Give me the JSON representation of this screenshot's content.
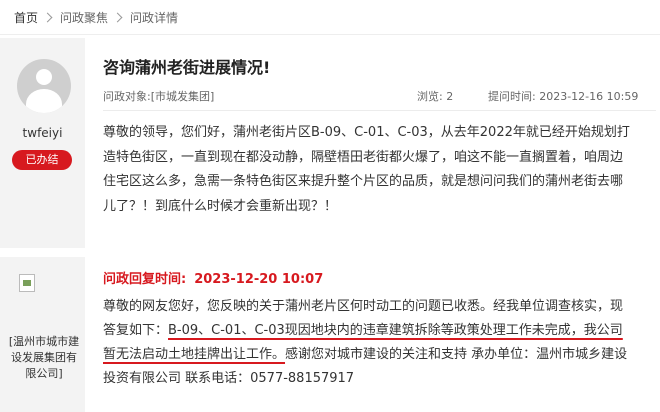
{
  "breadcrumb": {
    "items": [
      "首页",
      "问政聚焦",
      "问政详情"
    ]
  },
  "post": {
    "username": "twfeiyi",
    "status": "已办结",
    "title": "咨询蒲州老街进展情况!",
    "asked_label": "问政对象:",
    "asked_target": "[市城发集团]",
    "views_label": "浏览:",
    "views": "2",
    "time_label": "提问时间:",
    "time": "2023-12-16 10:59",
    "body": "尊敬的领导，您们好，蒲州老街片区B-09、C-01、C-03，从去年2022年就已经开始规划打造特色街区，一直到现在都没动静，隔壁梧田老街都火爆了，咱这不能一直搁置着，咱周边住宅区这么多，急需一条特色街区来提升整个片区的品质，就是想问问我们的蒲州老街去哪儿了？！到底什么时候才会重新出现？！"
  },
  "reply": {
    "org_name": "[温州市城市建设发展集团有限公司]",
    "header_label": "问政回复时间:",
    "header_time": "2023-12-20 10:07",
    "body_pre": "尊敬的网友您好，您反映的关于蒲州老片区何时动工的问题已收悉。经我单位调查核实，现答复如下：",
    "body_highlight": "B-09、C-01、C-03现因地块内的违章建筑拆除等政策处理工作未完成，我公司暂无法启动土地挂牌出让工作。",
    "body_post": "感谢您对城市建设的关注和支持 承办单位：温州市城乡建设投资有限公司 联系电话：0577-88157917"
  },
  "colors": {
    "accent": "#d7191f",
    "sidebar_bg": "#f3f3f3"
  }
}
